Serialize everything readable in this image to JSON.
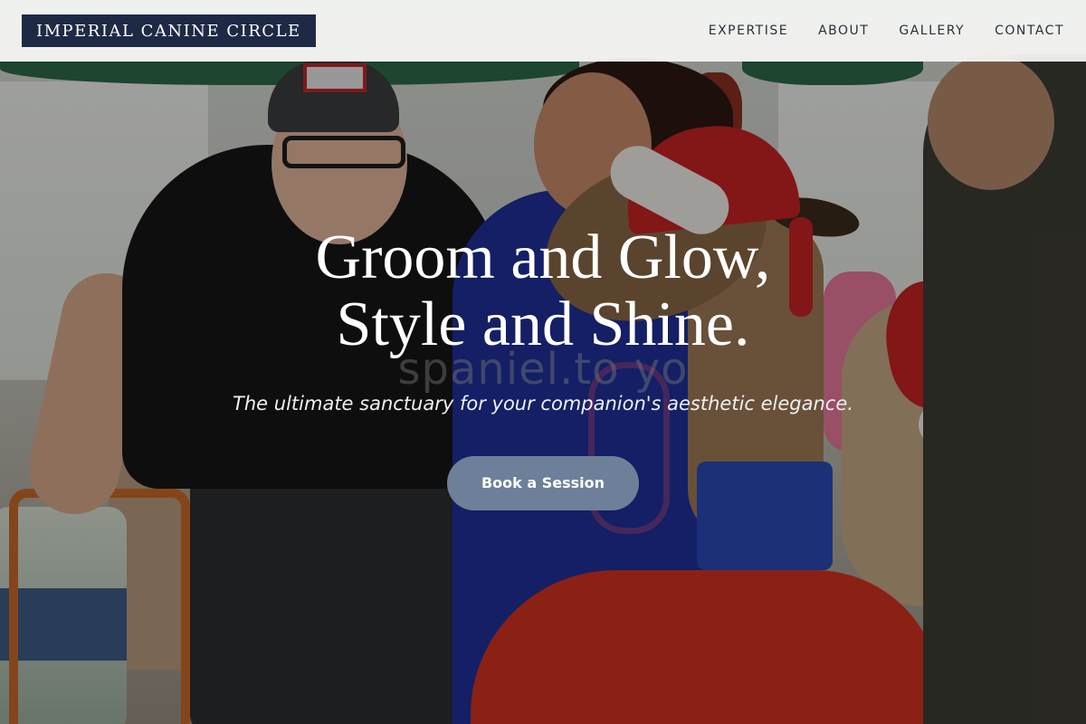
{
  "brand": {
    "logo_text": "IMPERIAL CANINE CIRCLE"
  },
  "nav": {
    "items": [
      {
        "label": "EXPERTISE"
      },
      {
        "label": "ABOUT"
      },
      {
        "label": "GALLERY"
      },
      {
        "label": "CONTACT"
      }
    ]
  },
  "hero": {
    "title_line1": "Groom and Glow,",
    "title_line2": "Style and Shine.",
    "subtitle": "The ultimate sanctuary for your companion's aesthetic elegance.",
    "cta_label": "Book a Session",
    "watermark": "spaniel.to yo"
  },
  "colors": {
    "logo_bg": "#1e2a45",
    "cta_bg": "#6e7f99",
    "nav_bg": "#f5f6f4"
  }
}
